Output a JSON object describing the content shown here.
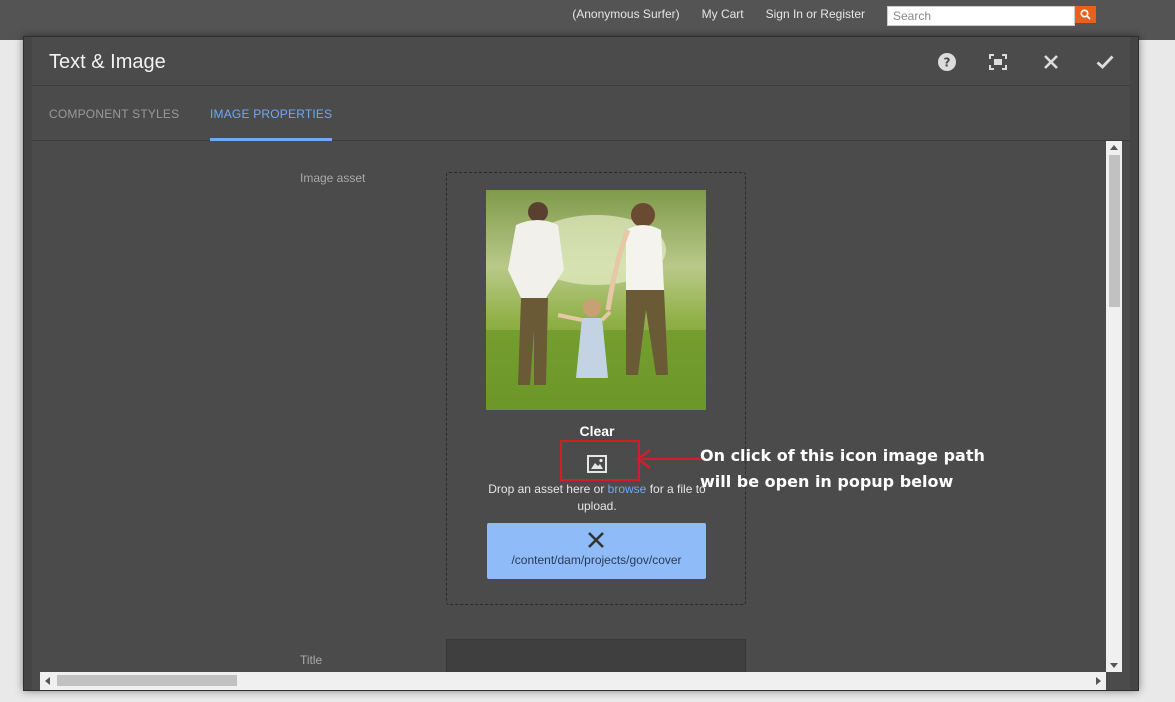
{
  "site_bar": {
    "user": "(Anonymous Surfer)",
    "cart": "My Cart",
    "signin": "Sign In or Register",
    "search_placeholder": "Search",
    "search_icon": "search-icon",
    "accent": "#e8601c"
  },
  "dialog": {
    "title": "Text & Image",
    "actions": [
      {
        "name": "help",
        "icon": "help-icon"
      },
      {
        "name": "fullscreen",
        "icon": "fullscreen-icon"
      },
      {
        "name": "cancel",
        "icon": "close-icon"
      },
      {
        "name": "done",
        "icon": "check-icon"
      }
    ],
    "tabs": [
      {
        "label": "COMPONENT STYLES",
        "active": false
      },
      {
        "label": "IMAGE PROPERTIES",
        "active": true
      }
    ],
    "tab_accent": "#6fa8f5"
  },
  "image_properties": {
    "image_asset_label": "Image asset",
    "clear_label": "Clear",
    "asset_icon": "image-icon",
    "drop_text_before": "Drop an asset here or ",
    "drop_text_link": "browse",
    "drop_text_after": " for a file to upload.",
    "asset_path": "/content/dam/projects/gov/cover",
    "remove_icon": "close-icon",
    "title_label": "Title"
  },
  "annotation": {
    "line1": "On click of this icon image path",
    "line2": "will be open in popup below",
    "color": "#d01e2a"
  }
}
